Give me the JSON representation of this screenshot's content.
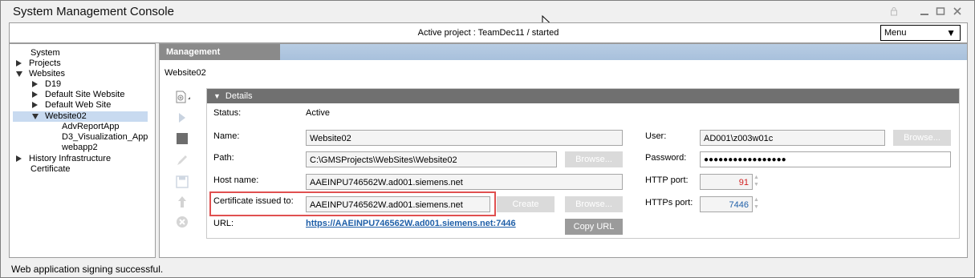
{
  "window": {
    "title": "System Management Console"
  },
  "project_bar": {
    "active_project": "Active project : TeamDec11 / started",
    "menu_label": "Menu"
  },
  "tree": {
    "items": [
      {
        "label": "System"
      },
      {
        "label": "Projects"
      },
      {
        "label": "Websites"
      },
      {
        "label": "D19"
      },
      {
        "label": "Default Site Website"
      },
      {
        "label": "Default Web Site"
      },
      {
        "label": "Website02"
      },
      {
        "label": "AdvReportApp"
      },
      {
        "label": "D3_Visualization_App"
      },
      {
        "label": "webapp2"
      },
      {
        "label": "History Infrastructure"
      },
      {
        "label": "Certificate"
      }
    ]
  },
  "panel": {
    "tab": "Management",
    "breadcrumb": "Website02"
  },
  "details": {
    "header": "Details",
    "status_label": "Status:",
    "status_value": "Active",
    "name_label": "Name:",
    "name_value": "Website02",
    "path_label": "Path:",
    "path_value": "C:\\GMSProjects\\WebSites\\Website02",
    "host_label": "Host name:",
    "host_value": "AAEINPU746562W.ad001.siemens.net",
    "cert_label": "Certificate issued to:",
    "cert_value": "AAEINPU746562W.ad001.siemens.net",
    "url_label": "URL:",
    "url_value": "https://AAEINPU746562W.ad001.siemens.net:7446",
    "user_label": "User:",
    "user_value": "AD001\\z003w01c",
    "password_label": "Password:",
    "password_value": "●●●●●●●●●●●●●●●●●",
    "http_label": "HTTP port:",
    "http_value": "91",
    "https_label": "HTTPs port:",
    "https_value": "7446",
    "browse_label": "Browse...",
    "create_label": "Create",
    "copy_url_label": "Copy URL"
  },
  "status_bar": {
    "message": "Web application signing successful."
  },
  "colors": {
    "http_port": "#d22020",
    "https_port": "#1f5fa8",
    "highlight": "#e05050",
    "tab": "#8a8a8a",
    "header": "#707070"
  }
}
